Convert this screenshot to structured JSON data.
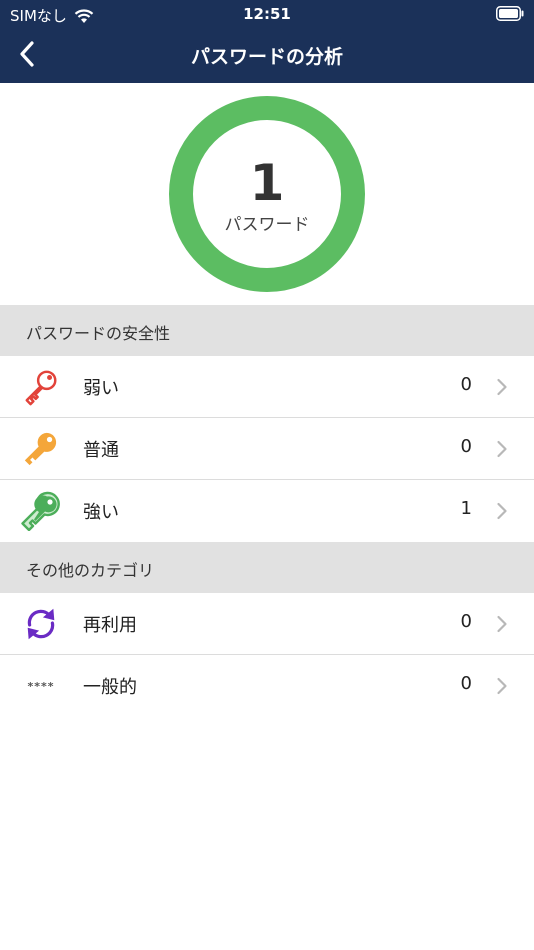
{
  "status_bar": {
    "carrier": "SIMなし",
    "time": "12:51"
  },
  "nav": {
    "title": "パスワードの分析"
  },
  "summary": {
    "count": "1",
    "label": "パスワード",
    "ring_color": "#5cbd62"
  },
  "safety_section": {
    "title": "パスワードの安全性",
    "items": [
      {
        "label": "弱い",
        "count": "0",
        "icon": "key-icon",
        "color": "#e2433a"
      },
      {
        "label": "普通",
        "count": "0",
        "icon": "key-icon",
        "color": "#f4a63a"
      },
      {
        "label": "強い",
        "count": "1",
        "icon": "key-icon",
        "color": "#4cae5a"
      }
    ]
  },
  "other_section": {
    "title": "その他のカテゴリ",
    "items": [
      {
        "label": "再利用",
        "count": "0",
        "icon": "refresh-icon",
        "color": "#6a2bc4"
      },
      {
        "label": "一般的",
        "count": "0",
        "icon": "asterisks-icon",
        "symbol": "****"
      }
    ]
  }
}
